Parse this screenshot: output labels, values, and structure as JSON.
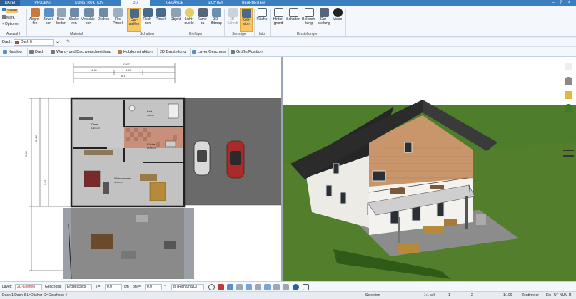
{
  "menu_tabs": [
    "DATEI",
    "PROJEKT",
    "KONSTRUKTION",
    "3D",
    "GELÄNDE",
    "SICHTEN",
    "BEARBEITEN"
  ],
  "active_tab": "3D",
  "ribbon": {
    "auswahl": {
      "selekt": "Selekt",
      "mark": "Mark.",
      "optionen": "Optionen",
      "group": "Auswahl"
    },
    "material": {
      "buttons": [
        "Abgrei-fen",
        "Zuwei-sen",
        "Bear-beiten",
        "Skalie-ren",
        "Verschie-ben",
        "Drehen",
        "Flis Pinsel"
      ],
      "group": "Material"
    },
    "schatten": {
      "buttons": [
        "Dar-stellen",
        "Rech-nen",
        "Pinsel"
      ],
      "group": "Schatten"
    },
    "einfuegen": {
      "buttons": [
        "Objekt",
        "Licht-quelle",
        "Kame-ra",
        "3D-Bitmap"
      ],
      "group": "Einfügen"
    },
    "sonstige": {
      "buttons": [
        "3D-Schnitt",
        "Kolli-sion"
      ],
      "group": "Sonstige"
    },
    "info": {
      "buttons": [
        "Fläche"
      ],
      "group": "Info"
    },
    "einstellungen": {
      "buttons": [
        "Hinter-grund",
        "Schatten",
        "Beleuch-tung",
        "Dar-stellung",
        "Video"
      ],
      "group": "Einstellungen"
    }
  },
  "dach_label": "Dach:",
  "dach_value": "Dach 8",
  "tool_tabs": [
    "Katalog",
    "Dach",
    "Wand- und Dachverschneidung",
    "Holzkonstruktion",
    "2D Darstellung",
    "Layer/Geschoss",
    "Größe/Position"
  ],
  "plan": {
    "rooms": [
      {
        "name": "Diele",
        "area": "12.16 m²"
      },
      {
        "name": "Bad",
        "area": "5.82 m²"
      },
      {
        "name": "Küche",
        "area": "10.50 m²"
      },
      {
        "name": "Wohnzimmer",
        "area": "48.80 m²"
      }
    ],
    "dims_top": [
      "11.67",
      "4.80",
      "4.40",
      "6.17"
    ],
    "dims_left": [
      "9.00",
      "11.44",
      "4.57"
    ]
  },
  "options_bar": {
    "layer_label": "Layer:",
    "layer_value": "2D-Elemen",
    "geschoss_label": "Geschoss:",
    "geschoss_value": "Erdgeschos",
    "l_label": "l =",
    "l_value": "0.0",
    "l_unit": "cm",
    "phi_label": "phi =",
    "phi_value": "0.0",
    "phi_unit": "°",
    "direction_value": "dl (Richtung/Di"
  },
  "status": {
    "left": "Dach 1 Dach 8 L=Dächer G=Geschoss 4",
    "mode": "Selektion",
    "sel": "1:1 sel",
    "x": "1",
    "y": "2",
    "scale": "1:100",
    "unit": "Zentimeter",
    "ein": "Ein",
    "flags": "UF NUM R"
  },
  "colors": {
    "accent": "#3c7fc1",
    "highlight": "#f6c667",
    "grass": "#4e7d2b",
    "sky": "#ffffff"
  }
}
